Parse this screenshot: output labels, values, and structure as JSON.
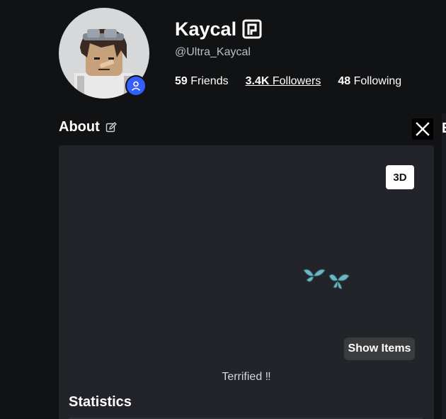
{
  "profile": {
    "display_name": "Kaycal",
    "username": "@Ultra_Kaycal",
    "friends_count": "59",
    "friends_label": "Friends",
    "followers_count": "3.4K",
    "followers_label": "Followers",
    "following_count": "48",
    "following_label": "Following"
  },
  "about": {
    "title": "About"
  },
  "avatar_panel": {
    "view_toggle_label": "3D",
    "show_items_label": "Show Items",
    "status": "Terrified ‼"
  },
  "statistics": {
    "title": "Statistics"
  },
  "side": {
    "edge_letter": "E"
  },
  "colors": {
    "background": "#111214",
    "panel": "#232429",
    "badge_blue": "#335fff",
    "button_white": "#ffffff",
    "button_dark": "#393b3d"
  },
  "icons": {
    "premium": "premium-icon",
    "edit": "edit-icon",
    "x_social": "x-logo-icon",
    "online_badge": "person-icon"
  }
}
